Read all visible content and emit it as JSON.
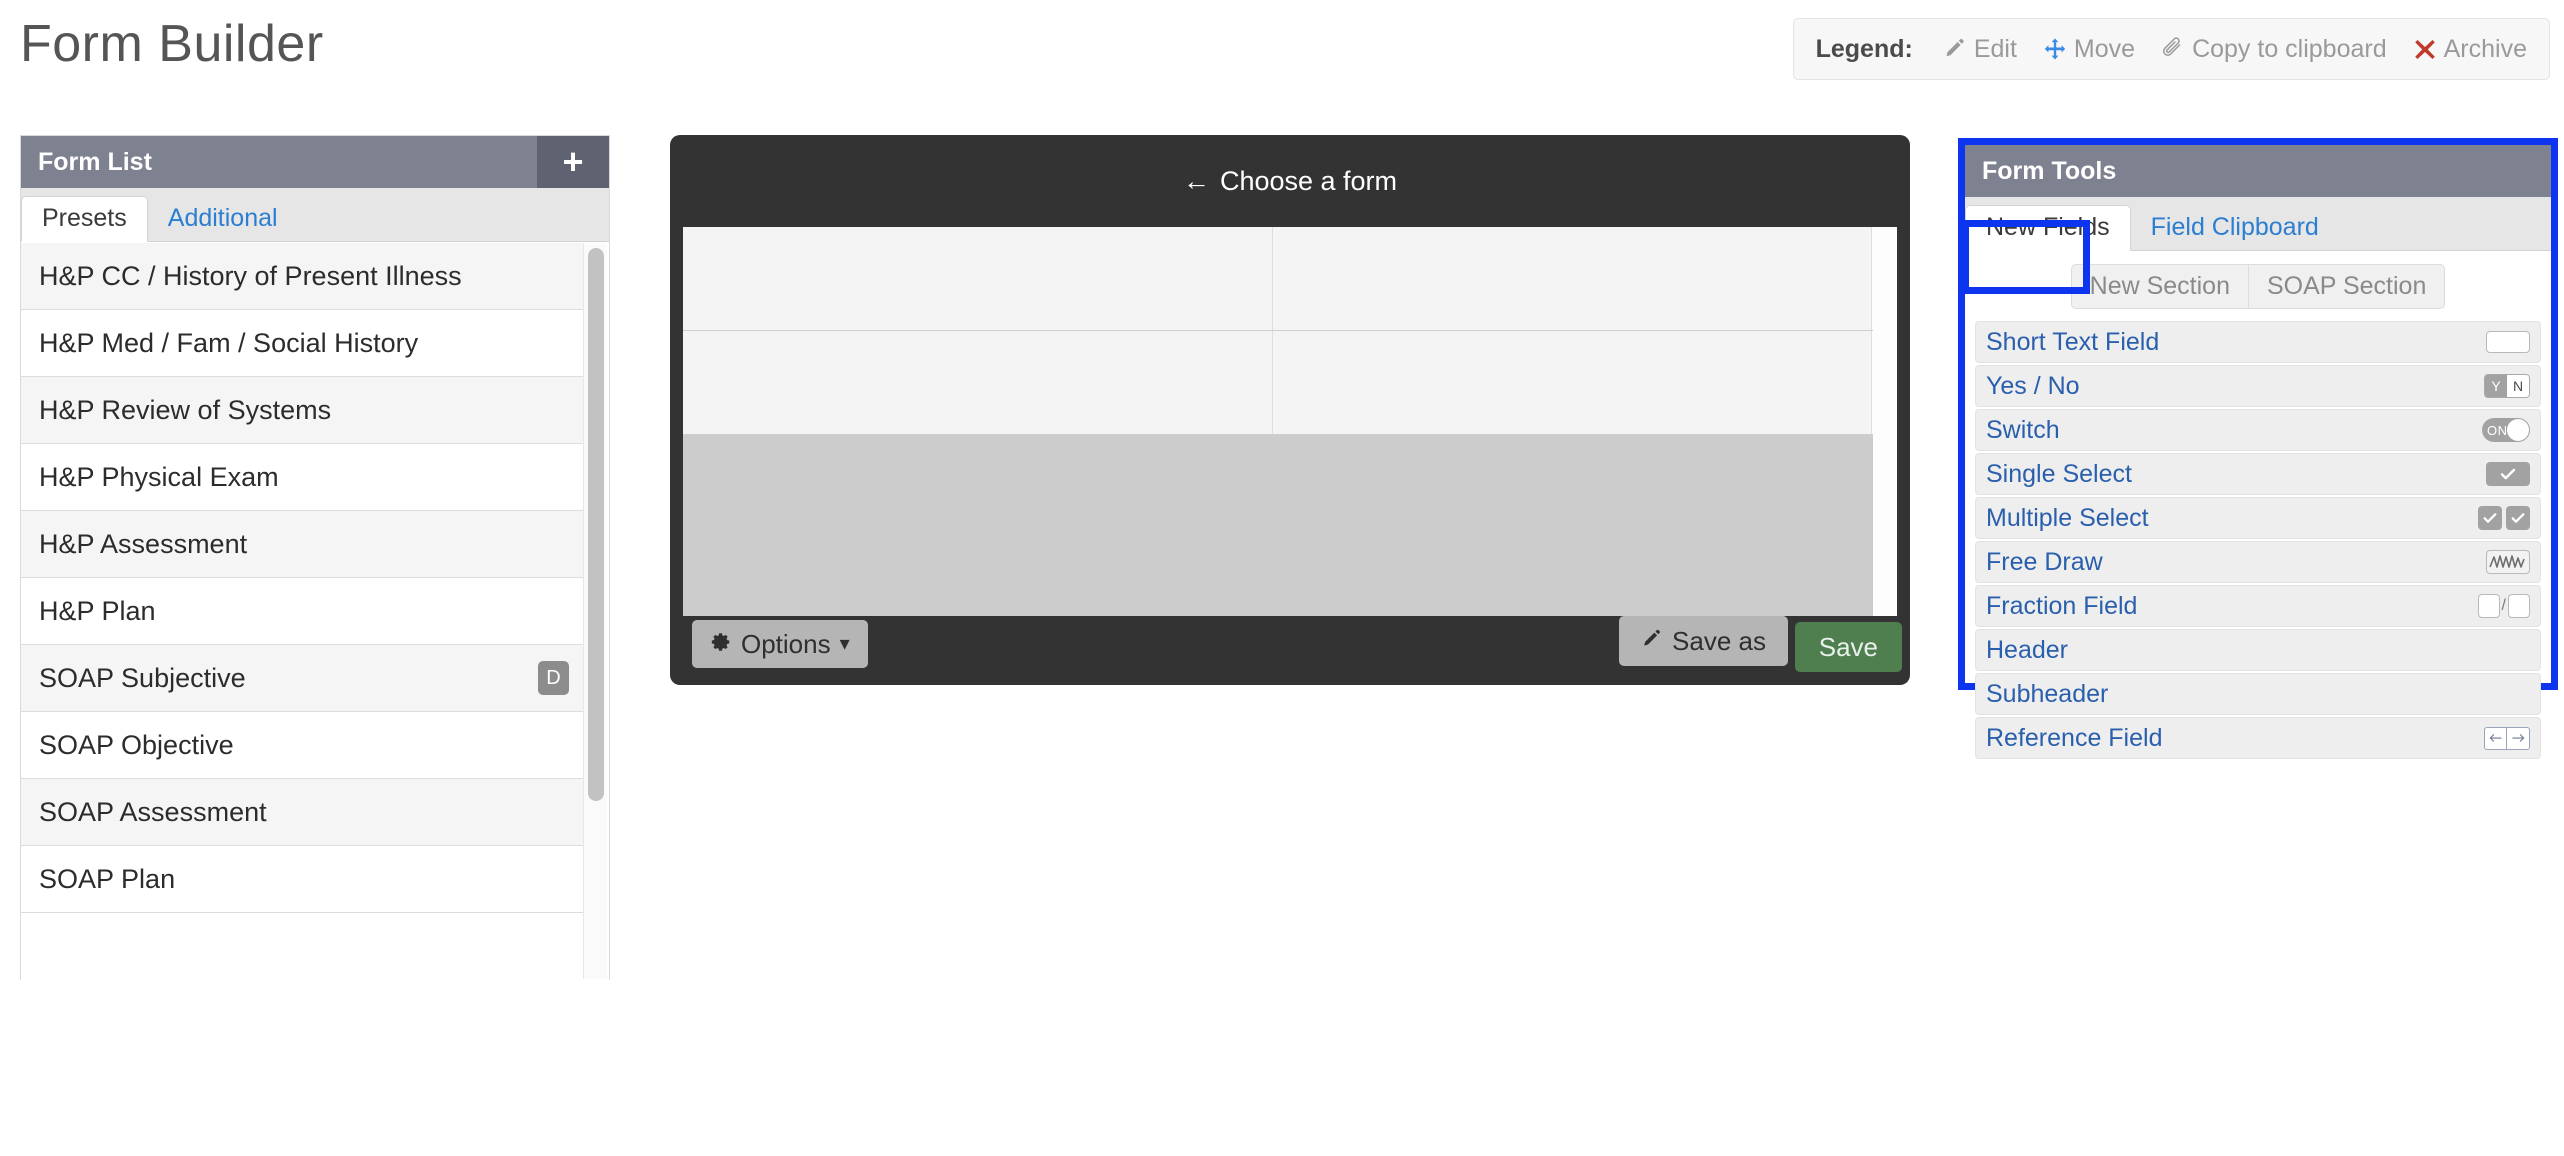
{
  "app": {
    "title": "Form Builder"
  },
  "legend": {
    "label": "Legend:",
    "items": [
      {
        "icon": "pencil-icon",
        "label": "Edit",
        "color": "#9a9a9a"
      },
      {
        "icon": "move-arrows-icon",
        "label": "Move",
        "color": "#9a9a9a"
      },
      {
        "icon": "paperclip-icon",
        "label": "Copy to clipboard",
        "color": "#9a9a9a"
      },
      {
        "icon": "red-x-icon",
        "label": "Archive",
        "color": "#9a9a9a"
      }
    ]
  },
  "form_list": {
    "title": "Form List",
    "add_button": "+",
    "tabs": [
      {
        "label": "Presets",
        "active": true
      },
      {
        "label": "Additional",
        "active": false
      }
    ],
    "rows": [
      {
        "label": "H&P CC / History of Present Illness",
        "badge": ""
      },
      {
        "label": "H&P Med / Fam / Social History",
        "badge": ""
      },
      {
        "label": "H&P Review of Systems",
        "badge": ""
      },
      {
        "label": "H&P Physical Exam",
        "badge": ""
      },
      {
        "label": "H&P Assessment",
        "badge": ""
      },
      {
        "label": "H&P Plan",
        "badge": ""
      },
      {
        "label": "SOAP Subjective",
        "badge": "D"
      },
      {
        "label": "SOAP Objective",
        "badge": ""
      },
      {
        "label": "SOAP Assessment",
        "badge": ""
      },
      {
        "label": "SOAP Plan",
        "badge": ""
      }
    ]
  },
  "builder": {
    "header": "Choose a form",
    "back_arrow": "←",
    "options_button": "Options",
    "options_caret": "▾",
    "save_as_button": "Save as",
    "save_button": "Save",
    "save_button_color": "#4f7f4f"
  },
  "form_tools": {
    "title": "Form Tools",
    "highlight_color": "#0d35f0",
    "tabs": [
      {
        "label": "New Fields",
        "active": true
      },
      {
        "label": "Field Clipboard",
        "active": false
      }
    ],
    "section_buttons": [
      {
        "label": "New Section"
      },
      {
        "label": "SOAP Section"
      }
    ],
    "fields": [
      {
        "label": "Short Text Field",
        "widget": "textbox"
      },
      {
        "label": "Yes / No",
        "widget": "yes-no",
        "y": "Y",
        "n": "N"
      },
      {
        "label": "Switch",
        "widget": "switch",
        "state": "ON"
      },
      {
        "label": "Single Select",
        "widget": "single-select"
      },
      {
        "label": "Multiple Select",
        "widget": "multi-select"
      },
      {
        "label": "Free Draw",
        "widget": "free-draw"
      },
      {
        "label": "Fraction Field",
        "widget": "fraction",
        "separator": "/"
      },
      {
        "label": "Header",
        "widget": "none"
      },
      {
        "label": "Subheader",
        "widget": "none"
      },
      {
        "label": "Reference Field",
        "widget": "reference"
      }
    ]
  },
  "colors": {
    "panel_header": "#7e8190",
    "dark_panel": "#333333",
    "link_blue": "#2b7ed1",
    "field_label_blue": "#2a5fad",
    "highlight_blue": "#0d35f0",
    "save_green": "#4f7f4f",
    "archive_red": "#c0392b"
  }
}
